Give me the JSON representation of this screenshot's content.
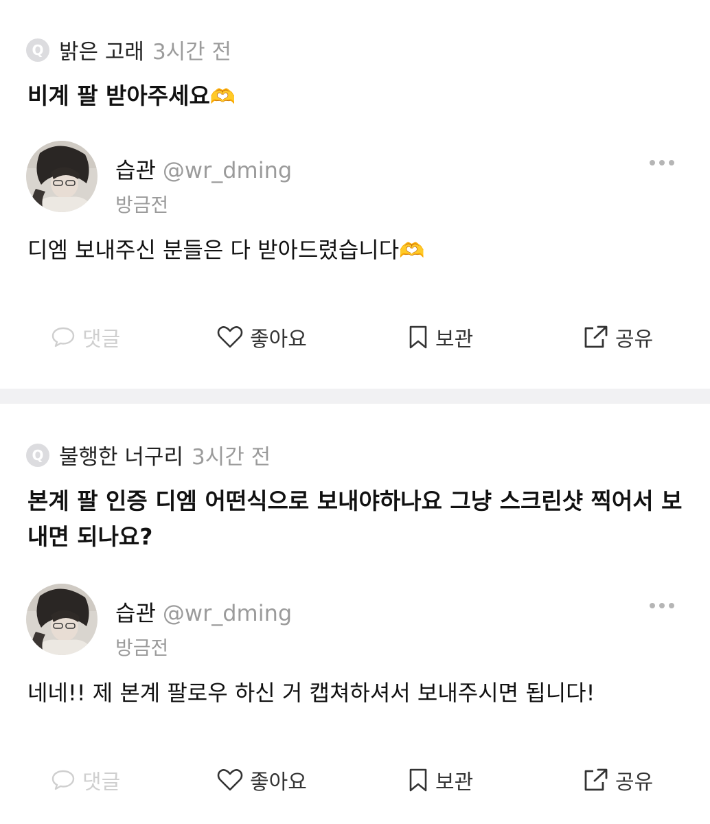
{
  "posts": [
    {
      "question_author": "밝은 고래",
      "question_time": "3시간 전",
      "question_text": "비계 팔 받아주세요",
      "question_emoji": "🫶",
      "reply_name": "습관",
      "reply_handle": "@wr_dming",
      "reply_time": "방금전",
      "reply_text": "디엠 보내주신 분들은 다 받아드렸습니다",
      "reply_emoji": "🫶"
    },
    {
      "question_author": "불행한 너구리",
      "question_time": "3시간 전",
      "question_text": "본계 팔 인증 디엠 어떤식으로 보내야하나요 그냥 스크린샷 찍어서 보내면 되나요?",
      "question_emoji": "",
      "reply_name": "습관",
      "reply_handle": "@wr_dming",
      "reply_time": "방금전",
      "reply_text": "네네!! 제 본계 팔로우 하신 거 캡쳐하셔서 보내주시면 됩니다!",
      "reply_emoji": ""
    }
  ],
  "badge_letter": "Q",
  "actions": {
    "comment": "댓글",
    "like": "좋아요",
    "save": "보관",
    "share": "공유"
  },
  "colors": {
    "muted": "#9b9b9b",
    "disabled": "#cfcfcf",
    "divider": "#f1f1f3"
  },
  "icons": [
    "chat-bubble-icon",
    "heart-icon",
    "bookmark-icon",
    "share-icon",
    "more-dots-icon"
  ]
}
